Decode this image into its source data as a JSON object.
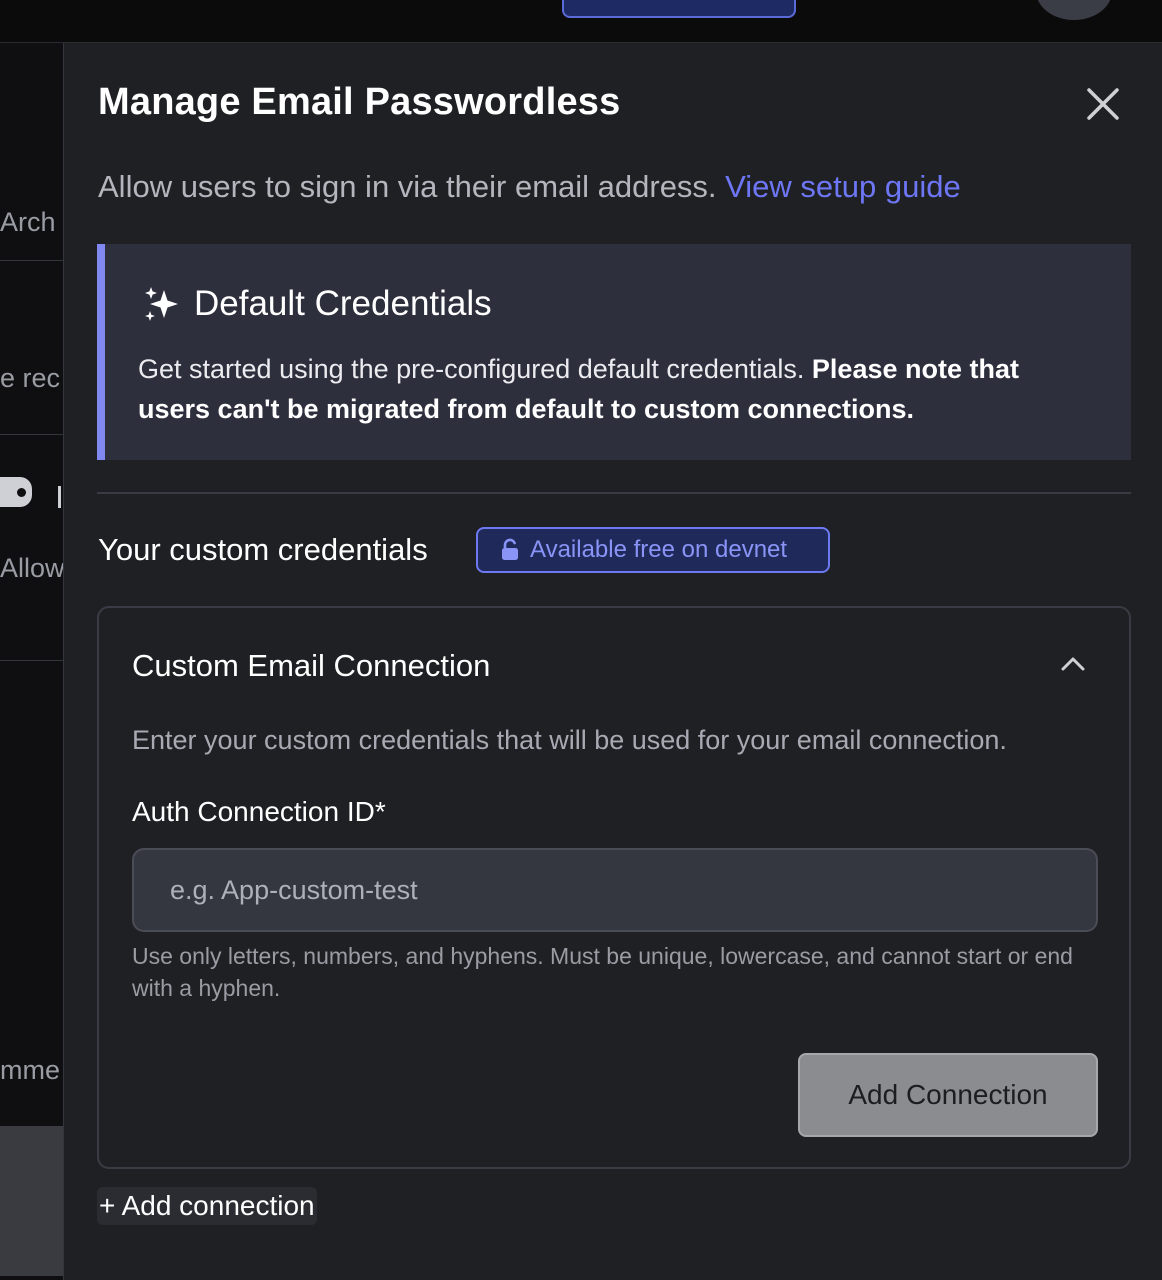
{
  "background": {
    "left_texts": [
      "Arch",
      "e rec",
      "Allow",
      "mme"
    ]
  },
  "modal": {
    "title": "Manage Email Passwordless",
    "description": "Allow users to sign in via their email address.",
    "guide_link": "View setup guide",
    "default_credentials": {
      "icon": "sparkle-icon",
      "title": "Default Credentials",
      "text": "Get started using the pre-configured default credentials.",
      "note": "Please note that users can't be migrated from default to custom connections."
    },
    "custom_credentials": {
      "label": "Your custom credentials",
      "badge": "Available free on devnet"
    },
    "connection_card": {
      "title": "Custom Email Connection",
      "description": "Enter your custom credentials that will be used for your email connection.",
      "field_label": "Auth Connection ID*",
      "field_placeholder": "e.g. App-custom-test",
      "field_value": "",
      "hint": "Use only letters, numbers, and hyphens. Must be unique, lowercase, and cannot start or end with a hyphen.",
      "submit_label": "Add Connection"
    },
    "add_connection_label": "+ Add connection"
  },
  "colors": {
    "modal_bg": "#1f2024",
    "accent": "#6d76f5",
    "default_box_bg": "#2d2f3c",
    "default_box_border": "#8089f2",
    "button_disabled": "#8b8c90"
  }
}
